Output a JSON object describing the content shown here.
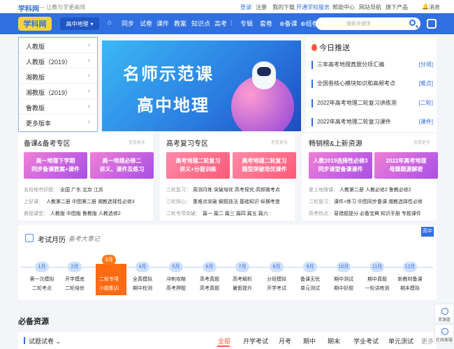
{
  "topbar": {
    "brand": "学科网",
    "slogan": "— 让教与学更高效",
    "login": "登录",
    "register": "注册",
    "downloads": "我的下载",
    "vip": "开通学校服务",
    "help": "帮助中心",
    "site_nav": "网站导航",
    "more": "旗下产品",
    "message": "消息"
  },
  "nav": {
    "logo": "学科网",
    "subject": "高中地理",
    "items": [
      "同步",
      "试卷",
      "课件",
      "教案",
      "知识点",
      "高考"
    ],
    "items2": [
      "专辑",
      "套卷",
      "备课",
      "组卷"
    ],
    "search_placeholder": "搜索关键字"
  },
  "left_list": [
    "人教版",
    "人教版（2019）",
    "湘教版",
    "湘教版（2019）",
    "鲁教版",
    "更多版本"
  ],
  "banner": {
    "line1": "名师示范课",
    "line2": "高中地理"
  },
  "news": {
    "title": "今日推送",
    "items": [
      {
        "text": "三年高考地理真题分项汇编",
        "tag": "[分项]"
      },
      {
        "text": "全国卷核心模块知识和高频考点",
        "tag": "[难点]"
      },
      {
        "text": "2022年高考地理二轮复习讲练测",
        "tag": "[二轮]"
      },
      {
        "text": "2022年高考地理二轮复习课件",
        "tag": "[课件]"
      }
    ]
  },
  "col1": {
    "title": "备课&备考专区",
    "more": "查看更多",
    "p1": "高一地理下学期",
    "p1b": "同步备课教案+课件",
    "p2": "高一地理必修二",
    "p2b": "讲义、课件及练习",
    "rows": [
      {
        "k": "名校地市好题：",
        "v": "全国 广东 北京 江苏"
      },
      {
        "k": "上好课：",
        "v": "人教第二册 中图第二册 湘教选择性必修3"
      },
      {
        "k": "晨题课堂：",
        "v": "人教版 中图版 鲁教版 人教选修2"
      }
    ]
  },
  "col2": {
    "title": "高考复习专区",
    "more": "查看更多",
    "p1": "高考地理二轮复习",
    "p1b": "讲义+分层训练",
    "p2": "高考地理二轮复习",
    "p2b": "题型突破培优课件",
    "rows": [
      {
        "k": "二轮复习：",
        "v": "周测月练 突破培优 高考探究 高频微考点"
      },
      {
        "k": "二轮核心：",
        "v": "重难点突破 解题技法 基础知识 纵横考查"
      },
      {
        "k": "二轮专项突破：",
        "v": "篇一 篇二 篇三 篇四 篇五 篇六"
      }
    ]
  },
  "col3": {
    "title": "畅销榜&上新资源",
    "more": "查看更多",
    "p1": "人教2019选择性必修3",
    "p1b": "同步课堂备课课件",
    "p2": "2022年高考地理",
    "p2b": "母题题源解密",
    "rows": [
      {
        "k": "爱上地理课：",
        "v": "人教第二册 人教必修2 鲁教必修2"
      },
      {
        "k": "二轮复习：",
        "v": "课件+练习 中图同步备课 湘教选择性必修"
      },
      {
        "k": "高考热点：",
        "v": "易错题提分 必备宝典 知识手册 专题课件"
      }
    ]
  },
  "calendar": {
    "title": "考试月历",
    "hand": "备考大事记",
    "grade": "高中",
    "months": [
      "1月",
      "2月",
      "3月",
      "4月",
      "5月",
      "6月",
      "7月",
      "8月",
      "9月",
      "10月",
      "11月",
      "12月"
    ],
    "events": [
      [
        "第一次模拟",
        "二轮考点"
      ],
      [
        "开学摸底",
        "二轮培优"
      ],
      [
        "二轮专项",
        "小题集训"
      ],
      [
        "全真模拟",
        "期中检测"
      ],
      [
        "冲刺攻略",
        "高考押题"
      ],
      [
        "高考真题",
        "高考真题"
      ],
      [
        "高考解析",
        "暑假提升"
      ],
      [
        "分班模拟",
        "开学考试"
      ],
      [
        "备课无忧",
        "单元测试"
      ],
      [
        "期中测试",
        "期中好题"
      ],
      [
        "期中真题",
        "一轮讲练测"
      ],
      [
        "新教材备课",
        "期末模拟"
      ]
    ]
  },
  "bottom": {
    "heading": "必备资源",
    "select": "试题试卷",
    "tabs": [
      "全部",
      "开学考试",
      "月考",
      "期中",
      "期末",
      "学业考试",
      "单元测试"
    ],
    "more": "更多"
  },
  "side": [
    "资源篮",
    "在线客服"
  ],
  "colors": {
    "primary": "#2f6fe0",
    "accent": "#ff6a12"
  }
}
